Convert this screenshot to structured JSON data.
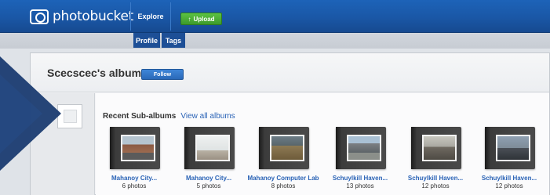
{
  "header": {
    "logo_text": "photobucket",
    "nav_explore": "Explore",
    "upload_label": "Upload"
  },
  "subnav": {
    "tabs": [
      {
        "label": "Profile"
      },
      {
        "label": "Tags"
      }
    ]
  },
  "album": {
    "title": "Scecscec's album",
    "follow_label": "Follow"
  },
  "recent": {
    "title": "Recent Sub-albums",
    "view_all": "View all albums",
    "items": [
      {
        "name": "Mahanoy City...",
        "count": "6 photos"
      },
      {
        "name": "Mahanoy City...",
        "count": "5 photos"
      },
      {
        "name": "Mahanoy Computer Lab",
        "count": "8 photos"
      },
      {
        "name": "Schuylkill Haven...",
        "count": "13 photos"
      },
      {
        "name": "Schuylkill Haven...",
        "count": "12 photos"
      },
      {
        "name": "Schuylkill Haven...",
        "count": "12 photos"
      }
    ]
  },
  "colors": {
    "header_blue": "#1a57a6",
    "upload_green": "#3d9b2c",
    "link_blue": "#2a63b6",
    "chevron_navy": "#1f3f73"
  },
  "icons": {
    "logo": "photobucket-logo-icon",
    "upload": "upload-arrow-icon",
    "overlay": "chevron-arrow-icon"
  }
}
